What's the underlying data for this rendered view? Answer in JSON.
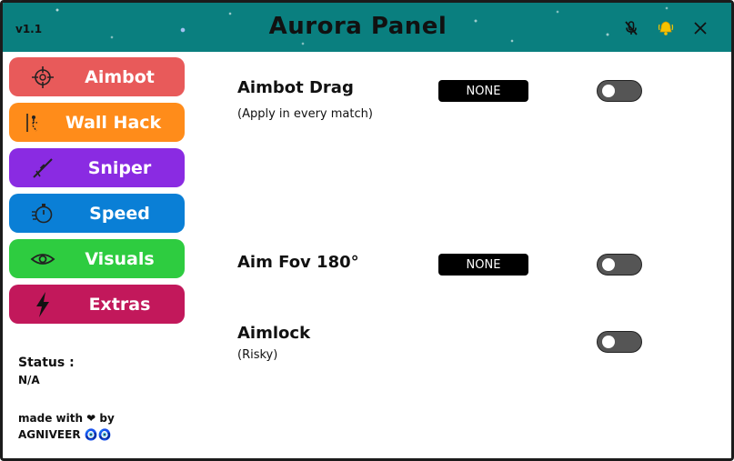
{
  "window": {
    "version": "v1.1",
    "title": "Aurora Panel",
    "controls": {
      "mute_icon": "mic-off-icon",
      "notify_icon": "bell-icon",
      "close_icon": "close-icon"
    }
  },
  "sidebar": {
    "items": [
      {
        "label": "Aimbot",
        "icon": "crosshair-icon",
        "color": "#e85a5a"
      },
      {
        "label": "Wall Hack",
        "icon": "wall-hack-icon",
        "color": "#ff8c1a"
      },
      {
        "label": "Sniper",
        "icon": "sniper-rifle-icon",
        "color": "#8a2be2"
      },
      {
        "label": "Speed",
        "icon": "stopwatch-icon",
        "color": "#0a7fd6"
      },
      {
        "label": "Visuals",
        "icon": "eye-icon",
        "color": "#2ecc40"
      },
      {
        "label": "Extras",
        "icon": "lightning-icon",
        "color": "#c2185b"
      }
    ],
    "status_label": "Status :",
    "status_value": "N/A",
    "credit_line1": "made with ❤ by",
    "credit_line2": "AGNIVEER 🧿🧿"
  },
  "main": {
    "options": [
      {
        "title": "Aimbot Drag",
        "subtitle": "(Apply in every match)",
        "key": "NONE",
        "enabled": false
      },
      {
        "title": "Aim Fov 180°",
        "subtitle": "",
        "key": "NONE",
        "enabled": false
      },
      {
        "title": "Aimlock",
        "subtitle": "(Risky)",
        "enabled": false
      }
    ]
  }
}
